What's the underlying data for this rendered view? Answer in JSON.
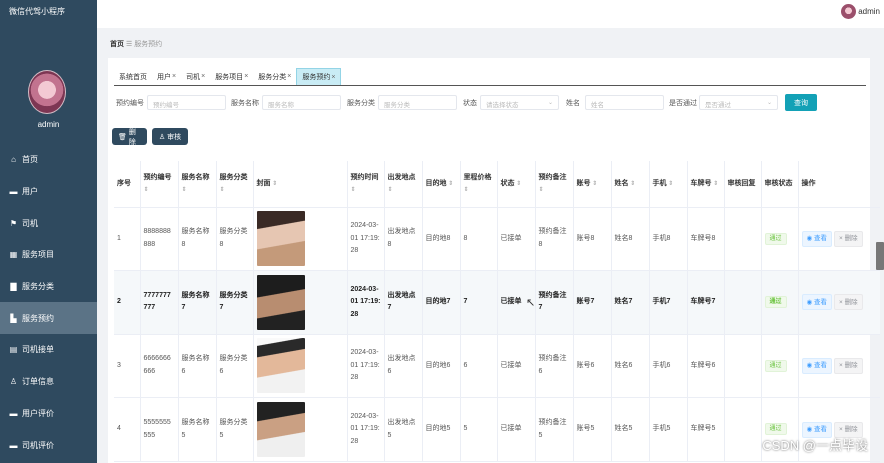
{
  "app": {
    "title": "微信代驾小程序",
    "user": "admin"
  },
  "topbar": {
    "user": "admin"
  },
  "sidebar": {
    "items": [
      {
        "label": "首页",
        "icon": "home-icon"
      },
      {
        "label": "用户",
        "icon": "user-icon"
      },
      {
        "label": "司机",
        "icon": "flag-icon"
      },
      {
        "label": "服务项目",
        "icon": "grid-icon"
      },
      {
        "label": "服务分类",
        "icon": "folder-icon"
      },
      {
        "label": "服务预约",
        "icon": "calendar-icon",
        "active": true
      },
      {
        "label": "司机接单",
        "icon": "list-icon"
      },
      {
        "label": "订单信息",
        "icon": "person-icon"
      },
      {
        "label": "用户评价",
        "icon": "comment-icon"
      },
      {
        "label": "司机评价",
        "icon": "comment-icon"
      }
    ]
  },
  "breadcrumb": {
    "home": "首页",
    "sep": "☰",
    "current": "服务预约"
  },
  "tabs": [
    {
      "label": "系统首页",
      "closable": false
    },
    {
      "label": "用户",
      "closable": true
    },
    {
      "label": "司机",
      "closable": true
    },
    {
      "label": "服务项目",
      "closable": true
    },
    {
      "label": "服务分类",
      "closable": true
    },
    {
      "label": "服务预约",
      "closable": true,
      "active": true
    }
  ],
  "search": {
    "booking_no": {
      "label": "预约编号",
      "placeholder": "预约编号"
    },
    "service_name": {
      "label": "服务名称",
      "placeholder": "服务名称"
    },
    "service_category": {
      "label": "服务分类",
      "placeholder": "服务分类"
    },
    "status": {
      "label": "状态",
      "placeholder": "请选择状态"
    },
    "name": {
      "label": "姓名",
      "placeholder": "姓名"
    },
    "approved": {
      "label": "是否通过",
      "placeholder": "是否通过"
    },
    "button": "查询"
  },
  "actions": {
    "delete": "删除",
    "review": "审核"
  },
  "table": {
    "headers": [
      "序号",
      "预约编号",
      "服务名称",
      "服务分类",
      "封面",
      "预约时间",
      "出发地点",
      "目的地",
      "里程价格",
      "状态",
      "预约备注",
      "账号",
      "姓名",
      "手机",
      "车牌号",
      "审核回复",
      "审核状态",
      "操作"
    ],
    "rows": [
      {
        "index": "1",
        "booking_no": "8888888888",
        "service_name": "服务名称8",
        "category": "服务分类8",
        "time": "2024-03-01 17:19:28",
        "from": "出发地点8",
        "to": "目的地8",
        "price": "8",
        "status": "已接单",
        "note": "预约备注8",
        "account": "账号8",
        "name": "姓名8",
        "phone": "手机8",
        "plate": "车牌号8",
        "reply": "",
        "review": "通过"
      },
      {
        "index": "2",
        "booking_no": "7777777777",
        "service_name": "服务名称7",
        "category": "服务分类7",
        "time": "2024-03-01 17:19:28",
        "from": "出发地点7",
        "to": "目的地7",
        "price": "7",
        "status": "已接单",
        "note": "预约备注7",
        "account": "账号7",
        "name": "姓名7",
        "phone": "手机7",
        "plate": "车牌号7",
        "reply": "",
        "review": "通过"
      },
      {
        "index": "3",
        "booking_no": "6666666666",
        "service_name": "服务名称6",
        "category": "服务分类6",
        "time": "2024-03-01 17:19:28",
        "from": "出发地点6",
        "to": "目的地6",
        "price": "6",
        "status": "已接单",
        "note": "预约备注6",
        "account": "账号6",
        "name": "姓名6",
        "phone": "手机6",
        "plate": "车牌号6",
        "reply": "",
        "review": "通过"
      },
      {
        "index": "4",
        "booking_no": "5555555555",
        "service_name": "服务名称5",
        "category": "服务分类5",
        "time": "2024-03-01 17:19:28",
        "from": "出发地点5",
        "to": "目的地5",
        "price": "5",
        "status": "已接单",
        "note": "预约备注5",
        "account": "账号5",
        "name": "姓名5",
        "phone": "手机5",
        "plate": "车牌号5",
        "reply": "",
        "review": "通过"
      }
    ],
    "row_actions": {
      "view": "查看",
      "delete": "删除"
    }
  },
  "watermark": "CSDN @一点毕设"
}
